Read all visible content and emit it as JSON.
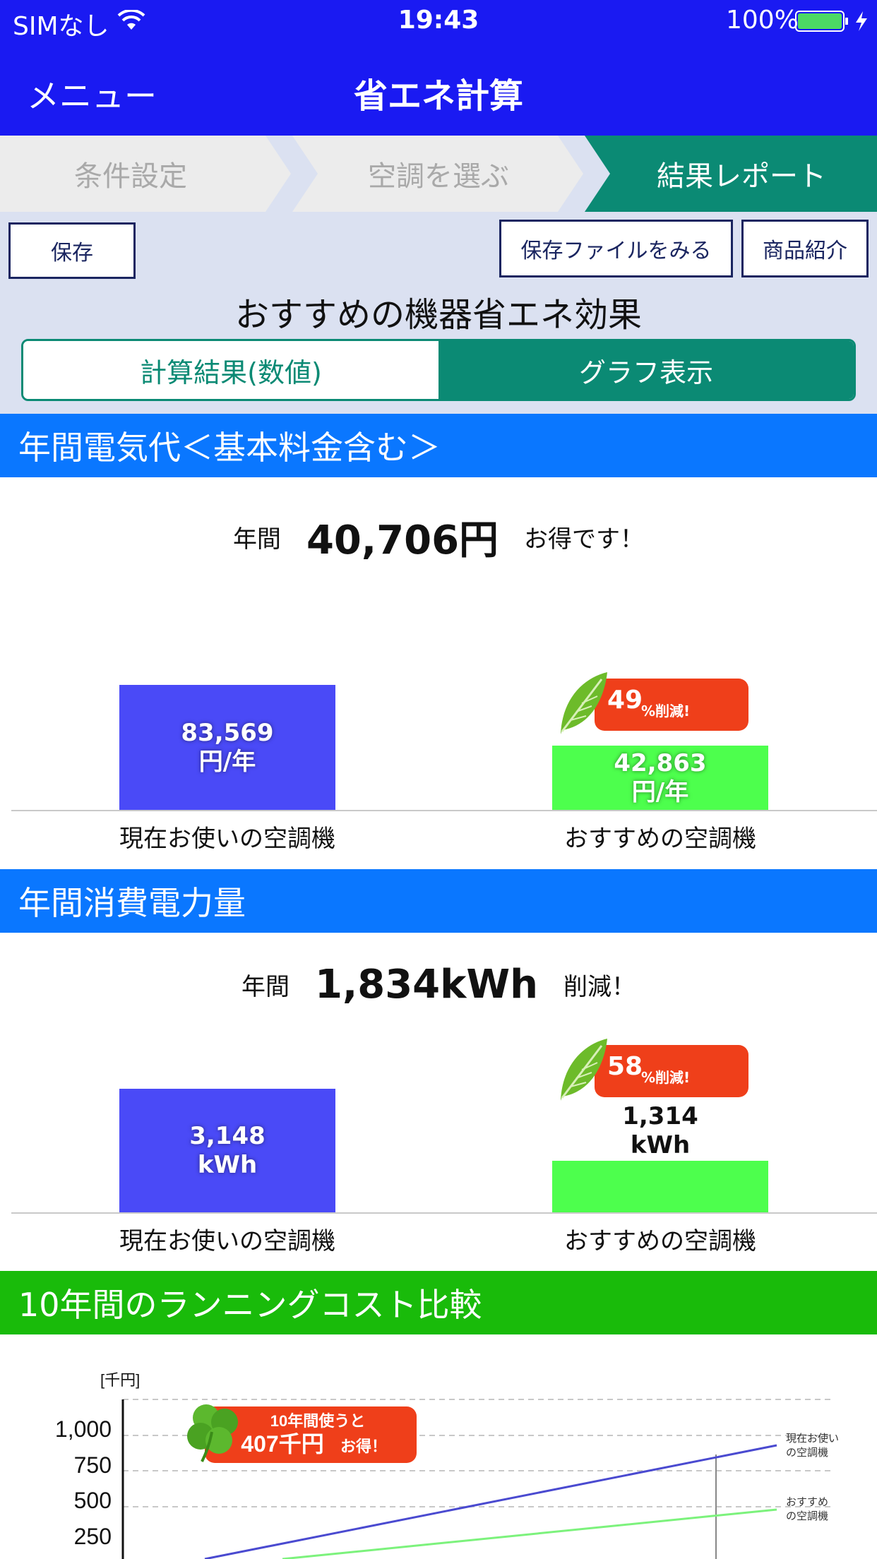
{
  "status_bar": {
    "carrier": "SIMなし",
    "time": "19:43",
    "battery": "100%"
  },
  "nav": {
    "menu_label": "メニュー",
    "title": "省エネ計算"
  },
  "steps": [
    {
      "label": "条件設定",
      "active": false
    },
    {
      "label": "空調を選ぶ",
      "active": false
    },
    {
      "label": "結果レポート",
      "active": true
    }
  ],
  "buttons": {
    "save": "保存",
    "view_saved": "保存ファイルをみる",
    "products": "商品紹介"
  },
  "main_title": "おすすめの機器省エネ効果",
  "segment": {
    "tab1": "計算結果(数値)",
    "tab2": "グラフ表示",
    "selected": "グラフ表示"
  },
  "section1": {
    "header": "年間電気代＜基本料金含む＞",
    "prefix": "年間",
    "amount": "40,706円",
    "suffix": "お得です！",
    "current": {
      "value": "83,569",
      "unit": "円/年",
      "label": "現在お使いの空調機",
      "number": 83569
    },
    "recommended": {
      "value": "42,863",
      "unit": "円/年",
      "label": "おすすめの空調機",
      "number": 42863
    },
    "badge": {
      "pct": "49",
      "text": "%削減!"
    }
  },
  "section2": {
    "header": "年間消費電力量",
    "prefix": "年間",
    "amount": "1,834kWh",
    "suffix": "削減！",
    "current": {
      "value": "3,148",
      "unit": "kWh",
      "label": "現在お使いの空調機",
      "number": 3148
    },
    "recommended": {
      "value": "1,314",
      "unit": "kWh",
      "label": "おすすめの空調機",
      "number": 1314
    },
    "badge": {
      "pct": "58",
      "text": "%削減!"
    }
  },
  "section3": {
    "header": "10年間のランニングコスト比較",
    "callout_line1": "10年間使うと",
    "callout_big": "407千円",
    "callout_suffix": "お得！"
  },
  "chart_data": {
    "type": "line",
    "ylabel": "[千円]",
    "yticks": [
      "1,000",
      "750",
      "500",
      "250"
    ],
    "series": [
      {
        "name": "現在お使い\nの空調機",
        "label_line1": "現在お使い",
        "label_line2": "の空調機",
        "color": "#4a4ad0"
      },
      {
        "name": "おすすめ\nの空調機",
        "label_line1": "おすすめ",
        "label_line2": "の空調機",
        "color": "#7cf27c"
      }
    ]
  },
  "colors": {
    "nav_blue": "#1a1af2",
    "teal": "#0b8a74",
    "section_blue": "#0a77ff",
    "section_green": "#19bb0a",
    "bar_current": "#4a4af7",
    "bar_recommended": "#4dff4d",
    "badge": "#ef3f1a"
  }
}
